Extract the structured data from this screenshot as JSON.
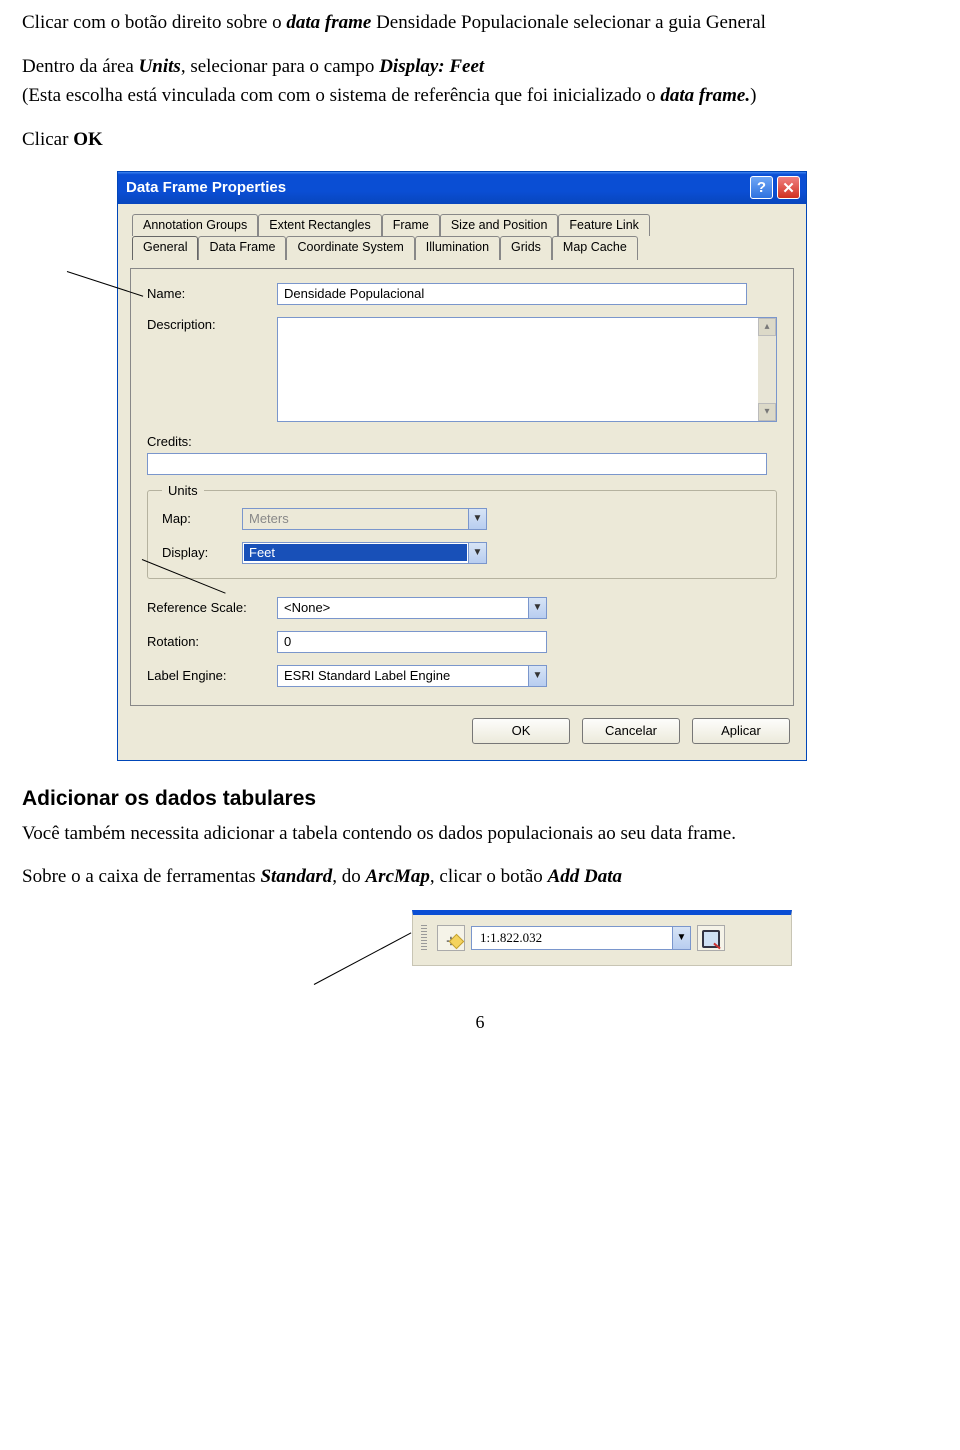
{
  "doc": {
    "para1_a": "Clicar com o botão direito sobre o ",
    "para1_b": "data frame",
    "para1_c": " Densidade Populacionale selecionar a guia General",
    "para2_a": "Dentro da área ",
    "para2_b": "Units",
    "para2_c": ", selecionar para o campo ",
    "para2_d": "Display: Feet",
    "para3": "(Esta escolha está vinculada com com o sistema de referência que foi inicializado o ",
    "para3_b": "data frame.",
    "para3_c": ")",
    "para4_a": "Clicar ",
    "para4_b": "OK",
    "heading": "Adicionar os dados tabulares",
    "para5": "Você também necessita adicionar a tabela contendo os dados populacionais ao seu data frame.",
    "para6_a": "Sobre o a caixa de ferramentas ",
    "para6_b": "Standard",
    "para6_c": ", do ",
    "para6_d": "ArcMap",
    "para6_e": ", clicar o botão ",
    "para6_f": "Add Data",
    "pagenum": "6"
  },
  "dialog": {
    "title": "Data Frame Properties",
    "tabs_row1": [
      "Annotation Groups",
      "Extent Rectangles",
      "Frame",
      "Size and Position",
      "Feature Link"
    ],
    "tabs_row2": [
      "General",
      "Data Frame",
      "Coordinate System",
      "Illumination",
      "Grids",
      "Map Cache"
    ],
    "labels": {
      "name": "Name:",
      "description": "Description:",
      "credits": "Credits:",
      "units_legend": "Units",
      "map": "Map:",
      "display": "Display:",
      "refscale": "Reference Scale:",
      "rotation": "Rotation:",
      "labelengine": "Label Engine:"
    },
    "values": {
      "name": "Densidade Populacional",
      "map_units": "Meters",
      "display_units": "Feet",
      "refscale": "<None>",
      "rotation": "0",
      "labelengine": "ESRI Standard Label Engine"
    },
    "buttons": {
      "ok": "OK",
      "cancel": "Cancelar",
      "apply": "Aplicar"
    }
  },
  "toolbar": {
    "scale": "1:1.822.032"
  }
}
